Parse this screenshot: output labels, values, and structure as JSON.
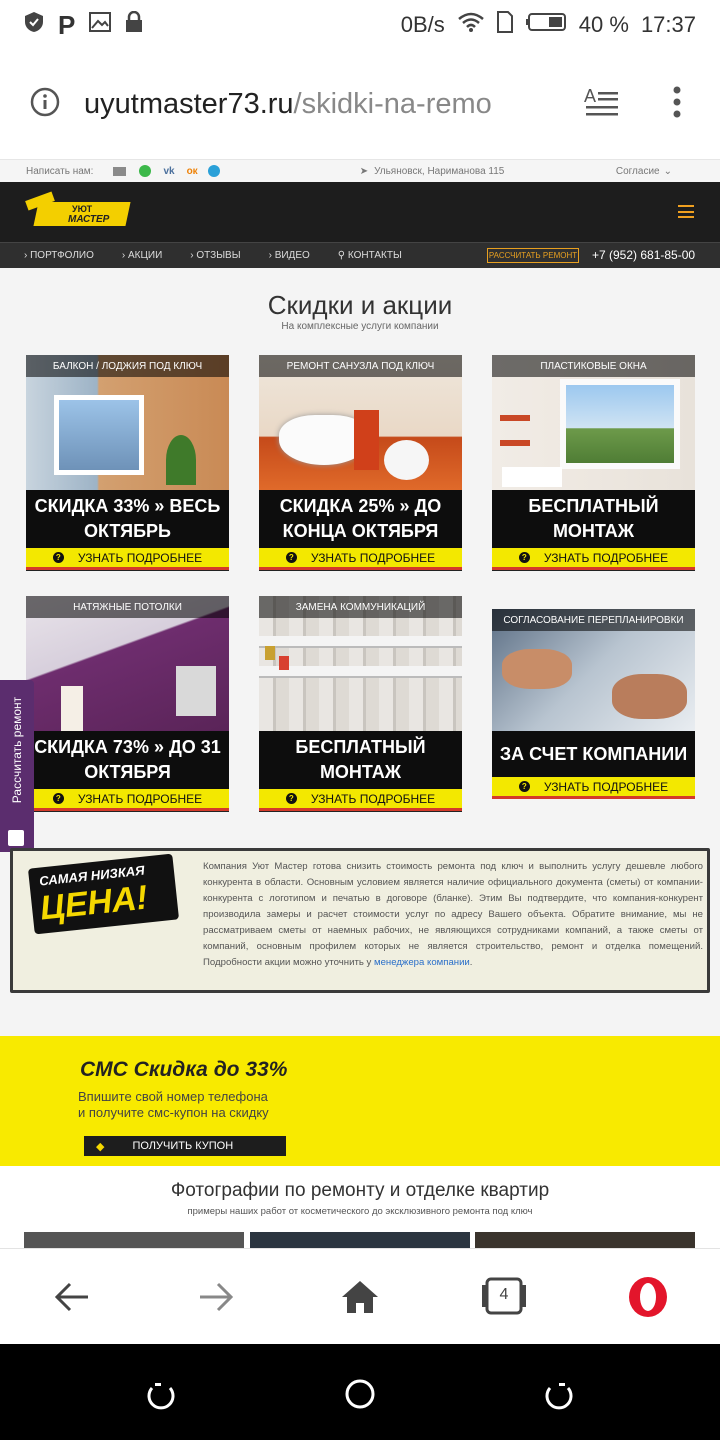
{
  "status": {
    "net": "0B/s",
    "battery": "40 %",
    "time": "17:37"
  },
  "browser": {
    "domain": "uyutmaster73.ru",
    "path": "/skidki-na-remo",
    "tabs_count": "4"
  },
  "site": {
    "topline": {
      "write_us": "Написать нам:",
      "address": "Ульяновск, Нариманова 115",
      "agree": "Согласие"
    },
    "logo": {
      "line1": "УЮТ",
      "line2": "МАСТЕР"
    },
    "nav": {
      "items": [
        "ПОРТФОЛИО",
        "АКЦИИ",
        "ОТЗЫВЫ",
        "ВИДЕО",
        "КОНТАКТЫ"
      ],
      "cta": "РАССЧИТАТЬ РЕМОНТ",
      "phone": "+7 (952) 681-85-00"
    },
    "section": {
      "title": "Скидки и акции",
      "subtitle": "На комплексные услуги компании"
    },
    "cards": [
      {
        "caption": "БАЛКОН / ЛОДЖИЯ ПОД КЛЮЧ",
        "offer": "СКИДКА 33% » ВЕСЬ ОКТЯБРЬ",
        "button": "УЗНАТЬ ПОДРОБНЕЕ"
      },
      {
        "caption": "РЕМОНТ САНУЗЛА ПОД КЛЮЧ",
        "offer": "СКИДКА 25% » ДО КОНЦА ОКТЯБРЯ",
        "button": "УЗНАТЬ ПОДРОБНЕЕ"
      },
      {
        "caption": "ПЛАСТИКОВЫЕ ОКНА",
        "offer": "БЕСПЛАТНЫЙ МОНТАЖ",
        "button": "УЗНАТЬ ПОДРОБНЕЕ"
      },
      {
        "caption": "НАТЯЖНЫЕ ПОТОЛКИ",
        "offer": "СКИДКА 73% » ДО 31 ОКТЯБРЯ",
        "button": "УЗНАТЬ ПОДРОБНЕЕ"
      },
      {
        "caption": "ЗАМЕНА КОММУНИКАЦИЙ",
        "offer": "БЕСПЛАТНЫЙ МОНТАЖ",
        "button": "УЗНАТЬ ПОДРОБНЕЕ"
      },
      {
        "caption": "СОГЛАСОВАНИЕ ПЕРЕПЛАНИРОВКИ",
        "offer": "ЗА СЧЕТ КОМПАНИИ",
        "button": "УЗНАТЬ ПОДРОБНЕЕ"
      }
    ],
    "promo": {
      "badge_top": "САМАЯ НИЗКАЯ",
      "badge_bottom": "ЦЕНА!",
      "text": "Компания Уют Мастер готова снизить стоимость ремонта под ключ и выполнить услугу дешевле любого конкурента в области. Основным условием является наличие официального документа (сметы) от компании-конкурента с логотипом и печатью в договоре (бланке). Этим Вы подтвердите, что компания-конкурент производила замеры и расчет стоимости услуг по адресу Вашего объекта. Обратите внимание, мы не рассматриваем сметы от наемных рабочих, не являющихся сотрудниками компаний, а также сметы от компаний, основным профилем которых не является строительство, ремонт и отделка помещений. Подробности акции можно уточнить у ",
      "link": "менеджера компании",
      "end": "."
    },
    "sms": {
      "title": "СМС Скидка до 33%",
      "line1": "Впишите свой номер телефона",
      "line2": "и получите смс-купон на скидку",
      "button": "ПОЛУЧИТЬ КУПОН"
    },
    "gallery": {
      "title": "Фотографии по ремонту и отделке квартир",
      "subtitle": "примеры наших работ от косметического до эксклюзивного ремонта под ключ"
    },
    "side_tab": "Рассчитать ремонт"
  }
}
